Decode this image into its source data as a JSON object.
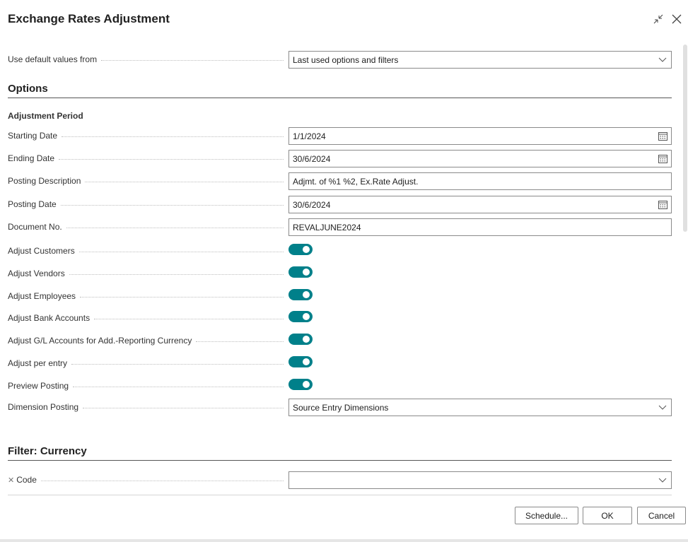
{
  "dialog": {
    "title": "Exchange Rates Adjustment"
  },
  "defaults": {
    "label": "Use default values from",
    "value": "Last used options and filters"
  },
  "options": {
    "section_title": "Options",
    "period_heading": "Adjustment Period",
    "starting_date": {
      "label": "Starting Date",
      "value": "1/1/2024"
    },
    "ending_date": {
      "label": "Ending Date",
      "value": "30/6/2024"
    },
    "posting_description": {
      "label": "Posting Description",
      "value": "Adjmt. of %1 %2, Ex.Rate Adjust."
    },
    "posting_date": {
      "label": "Posting Date",
      "value": "30/6/2024"
    },
    "document_no": {
      "label": "Document No.",
      "value": "REVALJUNE2024"
    },
    "toggles": [
      {
        "label": "Adjust Customers",
        "on": true
      },
      {
        "label": "Adjust Vendors",
        "on": true
      },
      {
        "label": "Adjust Employees",
        "on": true
      },
      {
        "label": "Adjust Bank Accounts",
        "on": true
      },
      {
        "label": "Adjust G/L Accounts for Add.-Reporting Currency",
        "on": true
      },
      {
        "label": "Adjust per entry",
        "on": true
      },
      {
        "label": "Preview Posting",
        "on": true
      }
    ],
    "dimension_posting": {
      "label": "Dimension Posting",
      "value": "Source Entry Dimensions"
    }
  },
  "filter": {
    "section_title": "Filter: Currency",
    "code": {
      "label": "Code",
      "value": ""
    }
  },
  "buttons": {
    "schedule": "Schedule...",
    "ok": "OK",
    "cancel": "Cancel"
  },
  "icons": {
    "collapse": "collapse-icon",
    "close": "close-icon",
    "calendar": "calendar-icon",
    "chevron": "chevron-down-icon",
    "remove_filter": "remove-filter-icon"
  },
  "colors": {
    "toggle_on": "#00808a"
  }
}
